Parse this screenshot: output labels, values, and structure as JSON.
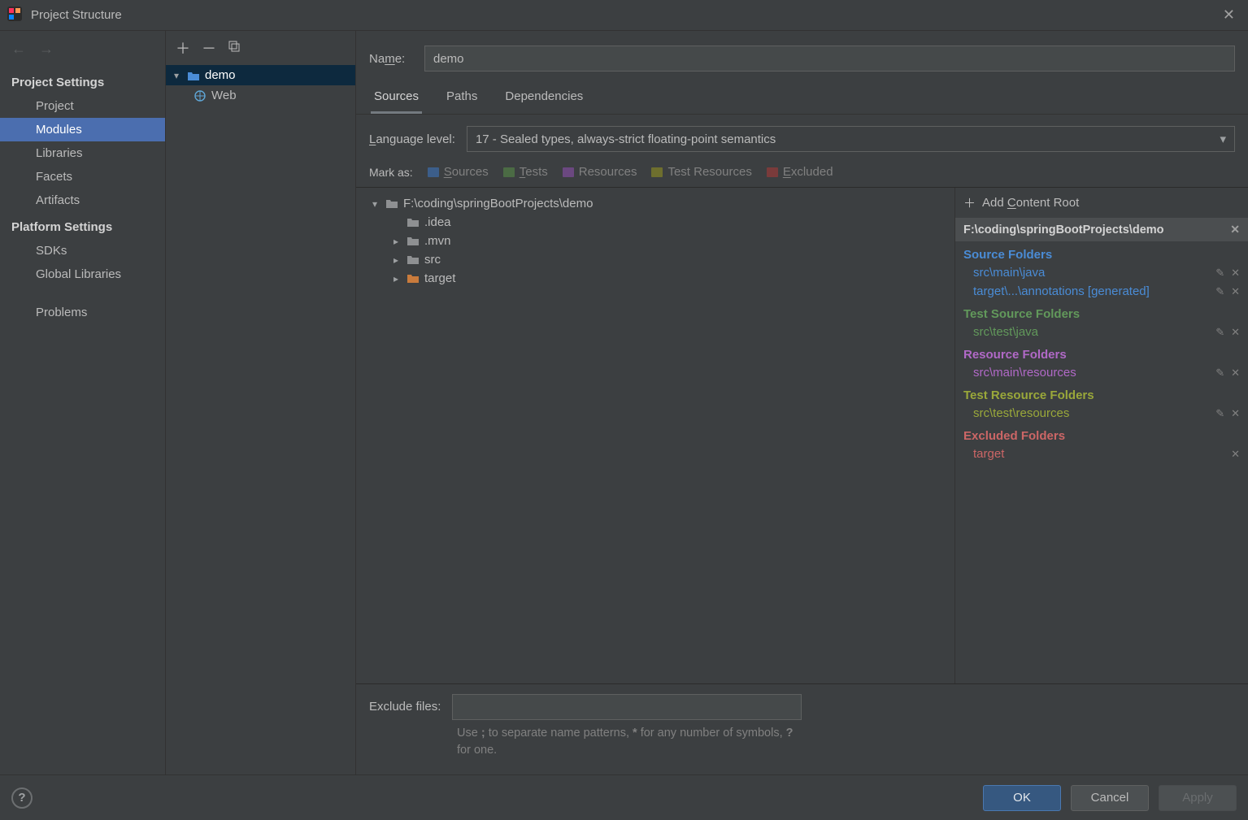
{
  "window": {
    "title": "Project Structure"
  },
  "sidebar": {
    "sections": [
      {
        "title": "Project Settings",
        "items": [
          "Project",
          "Modules",
          "Libraries",
          "Facets",
          "Artifacts"
        ],
        "selectedIndex": 1
      },
      {
        "title": "Platform Settings",
        "items": [
          "SDKs",
          "Global Libraries"
        ]
      }
    ],
    "problems": "Problems"
  },
  "modules": {
    "root": {
      "name": "demo",
      "expanded": true
    },
    "child": {
      "name": "Web"
    }
  },
  "detail": {
    "nameLabel": "Name:",
    "nameValue": "demo",
    "tabs": [
      "Sources",
      "Paths",
      "Dependencies"
    ],
    "activeTab": 0,
    "langLabel": "Language level:",
    "langValue": "17 - Sealed types, always-strict floating-point semantics",
    "markAsLabel": "Mark as:",
    "markOptions": [
      "Sources",
      "Tests",
      "Resources",
      "Test Resources",
      "Excluded"
    ],
    "tree": {
      "root": "F:\\coding\\springBootProjects\\demo",
      "children": [
        {
          "name": ".idea",
          "hasChildren": false
        },
        {
          "name": ".mvn",
          "hasChildren": true
        },
        {
          "name": "src",
          "hasChildren": true
        },
        {
          "name": "target",
          "hasChildren": true,
          "excluded": true
        }
      ]
    },
    "roots": {
      "addLabel": "Add Content Root",
      "path": "F:\\coding\\springBootProjects\\demo",
      "groups": [
        {
          "title": "Source Folders",
          "cls": "blue",
          "items": [
            {
              "text": "src\\main\\java",
              "editable": true
            },
            {
              "text": "target\\...\\annotations [generated]",
              "editable": true
            }
          ]
        },
        {
          "title": "Test Source Folders",
          "cls": "green",
          "items": [
            {
              "text": "src\\test\\java",
              "editable": true
            }
          ]
        },
        {
          "title": "Resource Folders",
          "cls": "purple",
          "items": [
            {
              "text": "src\\main\\resources",
              "editable": true
            }
          ]
        },
        {
          "title": "Test Resource Folders",
          "cls": "olive",
          "items": [
            {
              "text": "src\\test\\resources",
              "editable": true
            }
          ]
        },
        {
          "title": "Excluded Folders",
          "cls": "red",
          "items": [
            {
              "text": "target",
              "editable": false
            }
          ]
        }
      ]
    },
    "exclude": {
      "label": "Exclude files:",
      "value": "",
      "hint": "Use ; to separate name patterns, * for any number of symbols, ? for one."
    }
  },
  "footer": {
    "ok": "OK",
    "cancel": "Cancel",
    "apply": "Apply"
  }
}
